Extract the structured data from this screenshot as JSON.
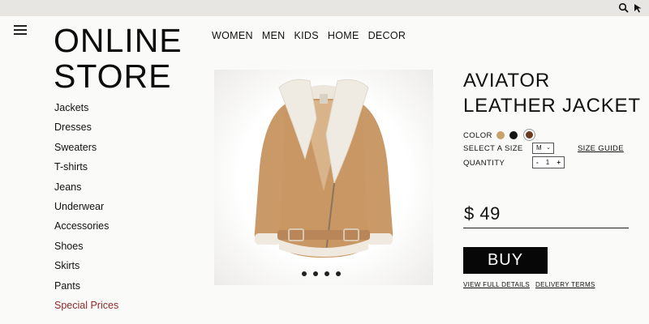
{
  "header": {
    "icons": [
      "search-icon",
      "cursor-icon"
    ],
    "menu_icon": "hamburger-menu-icon"
  },
  "logo": {
    "line1": "ONLINE",
    "line2": "STORE"
  },
  "nav": {
    "items": [
      "WOMEN",
      "MEN",
      "KIDS",
      "HOME",
      "DECOR"
    ]
  },
  "sidebar": {
    "items": [
      "Jackets",
      "Dresses",
      "Sweaters",
      "T-shirts",
      "Jeans",
      "Underwear",
      "Accessories",
      "Shoes",
      "Skirts",
      "Pants",
      "Special Prices"
    ],
    "special_color": "#8b2a2a"
  },
  "product": {
    "title_line1": "AVIATOR",
    "title_line2": "LEATHER JACKET",
    "color_label": "COLOR",
    "colors": [
      "#c9a26a",
      "#151515",
      "#6b3a1f"
    ],
    "size_label": "SELECT A SIZE",
    "size_value": "M",
    "size_guide": "SIZE GUIDE",
    "quantity_label": "QUANTITY",
    "quantity_minus": "-",
    "quantity_value": "1",
    "quantity_plus": "+",
    "price": "$ 49",
    "buy_label": "BUY",
    "full_details": "VIEW FULL DETAILS",
    "delivery_terms": "DELIVERY TERMS",
    "image_name": "aviator-jacket-image",
    "carousel_dots": 4
  }
}
